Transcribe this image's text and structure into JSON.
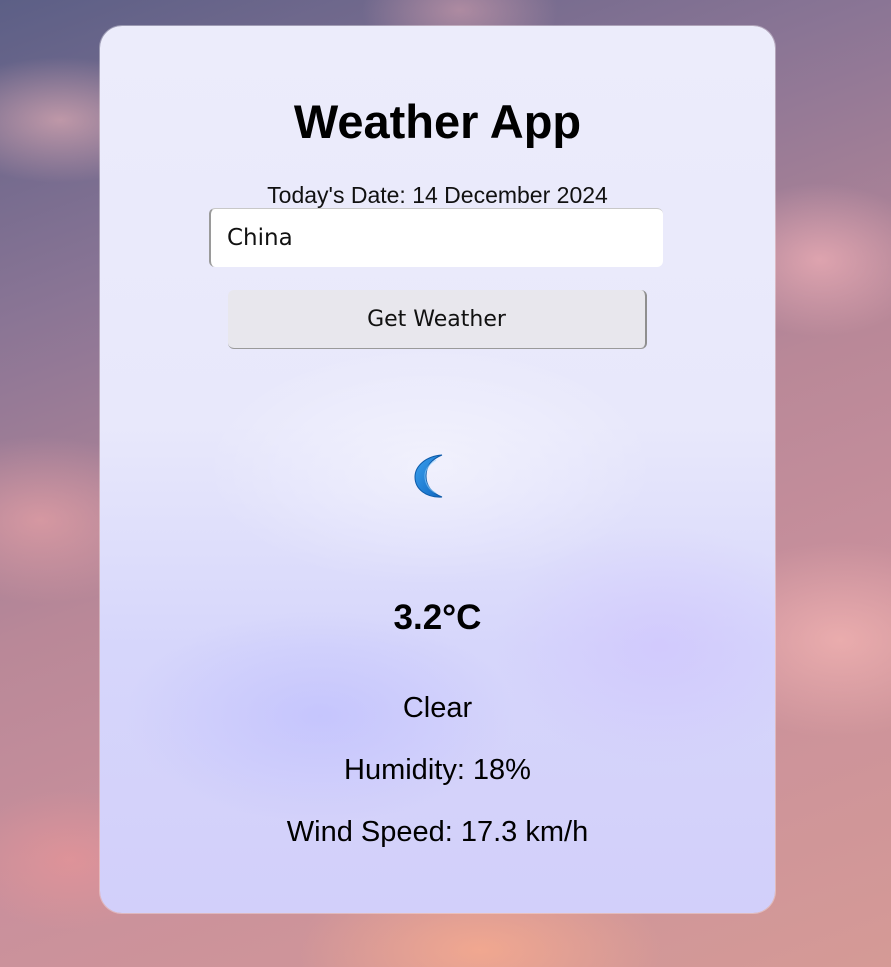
{
  "app": {
    "title": "Weather App"
  },
  "date": {
    "label": "Today's Date: 14 December 2024"
  },
  "search": {
    "value": "China",
    "button_label": "Get Weather"
  },
  "weather": {
    "icon": "crescent-moon-icon",
    "icon_color": "#1a7fd4",
    "temperature": "3.2°C",
    "description": "Clear",
    "humidity": "Humidity: 18%",
    "wind_speed": "Wind Speed: 17.3 km/h"
  }
}
